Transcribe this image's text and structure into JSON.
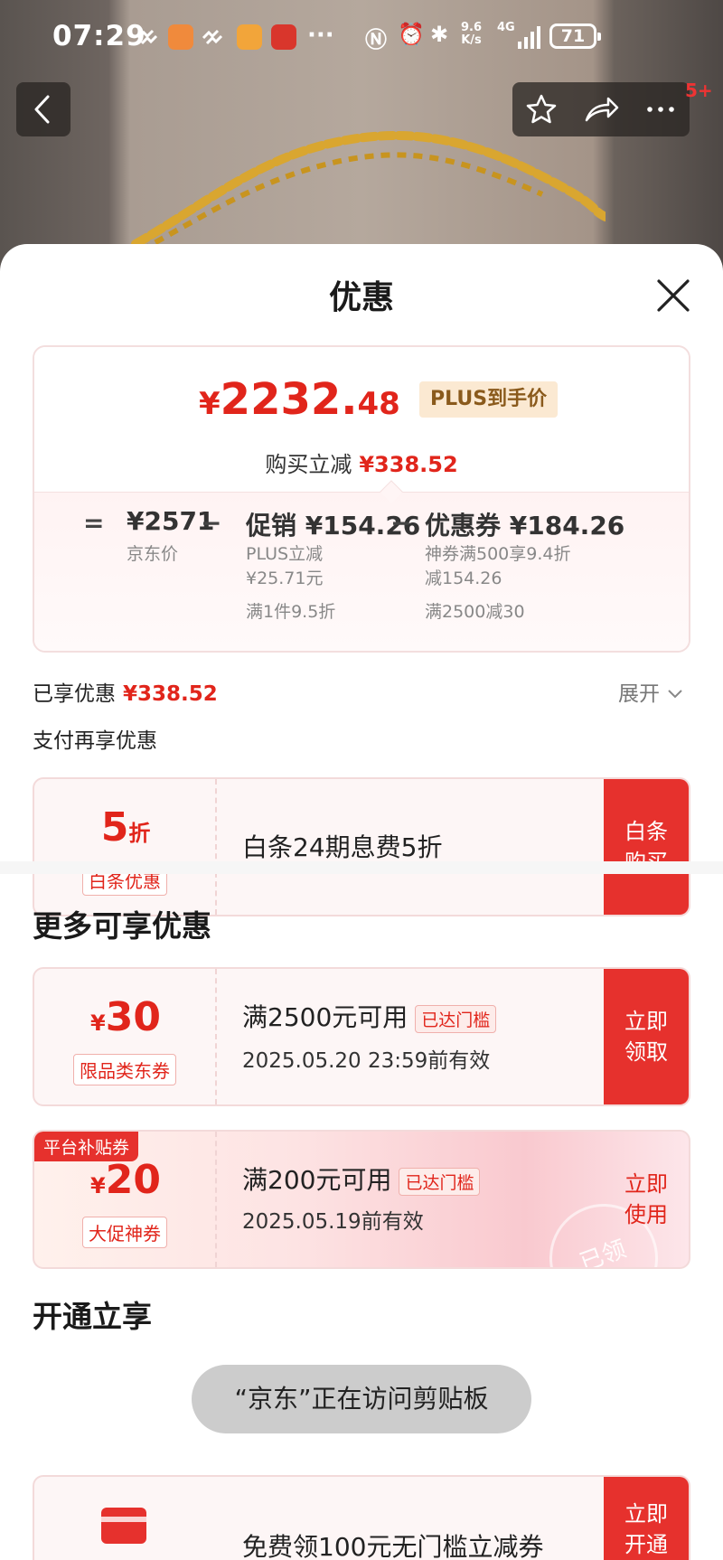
{
  "status_bar": {
    "time": "07:29",
    "network_speed": "9.6\nK/s",
    "network_type": "4G",
    "battery": "71"
  },
  "nav": {
    "badge": "5+"
  },
  "sheet": {
    "title": "优惠"
  },
  "price_card": {
    "currency": "¥",
    "final_int": "2232.",
    "final_dec": "48",
    "plus_tag": "PLUS到手价",
    "reduce_label": "购买立减",
    "reduce_value": "¥338.52",
    "eq": "=",
    "minus1": "−",
    "minus2": "−",
    "jd_price_value": "¥2571",
    "jd_price_label": "京东价",
    "promo_value": "促销 ¥154.26",
    "promo_line1": "PLUS立减",
    "promo_line2": "¥25.71元",
    "promo_line3": "满1件9.5折",
    "coupon_value": "优惠券 ¥184.26",
    "coupon_line1": "神券满500享9.4折",
    "coupon_line2": "减154.26",
    "coupon_line3": "满2500减30"
  },
  "enjoyed": {
    "label": "已享优惠",
    "value": "¥338.52",
    "expand": "展开"
  },
  "pay_more": "支付再享优惠",
  "baitiao": {
    "amount": "5",
    "unit": "折",
    "tag": "白条优惠",
    "desc": "白条24期息费5折",
    "button": "白条\n购买"
  },
  "more_title": "更多可享优惠",
  "coupons": [
    {
      "currency": "¥",
      "amount": "30",
      "tag": "限品类东券",
      "main": "满2500元可用",
      "badge": "已达门槛",
      "sub": "2025.05.20 23:59前有效",
      "button": "立即\n领取"
    },
    {
      "platform_tag": "平台补贴券",
      "currency": "¥",
      "amount": "20",
      "tag": "大促神券",
      "main": "满200元可用",
      "badge": "已达门槛",
      "sub": "2025.05.19前有效",
      "button": "立即\n使用",
      "stamp": "已领"
    }
  ],
  "open_title": "开通立享",
  "open_card": {
    "desc": "免费领100元无门槛立减券",
    "button": "立即\n开通"
  },
  "toast": "“京东”正在访问剪贴板",
  "colors": {
    "accent_red": "#e1251b",
    "button_red": "#e6312d",
    "plus_gold_bg": "#fbe9d2"
  }
}
